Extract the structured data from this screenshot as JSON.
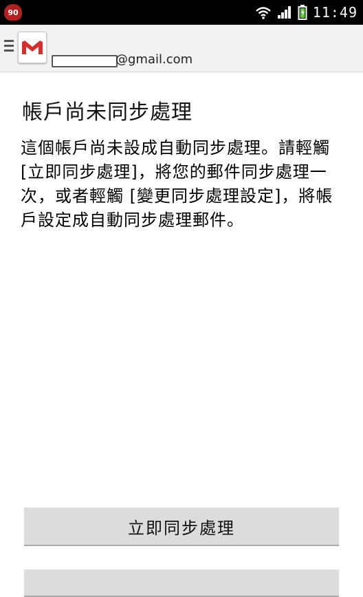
{
  "status_bar": {
    "notification_count": "90",
    "time": "11:49",
    "icons": [
      "wifi-icon",
      "signal-icon",
      "battery-charging-icon"
    ]
  },
  "action_bar": {
    "account_suffix": "@gmail.com",
    "logo": "gmail-logo-icon"
  },
  "content": {
    "title": "帳戶尚未同步處理",
    "message": "這個帳戶尚未設成自動同步處理。請輕觸 [立即同步處理]，將您的郵件同步處理一次，或者輕觸 [變更同步處理設定]，將帳戶設定成自動同步處理郵件。"
  },
  "buttons": {
    "sync_now": "立即同步處理",
    "change_settings": ""
  },
  "colors": {
    "status_bar": "#000000",
    "action_bar": "#f2f2f2",
    "button": "#dcdcdc",
    "gmail_red": "#d32f2f"
  }
}
